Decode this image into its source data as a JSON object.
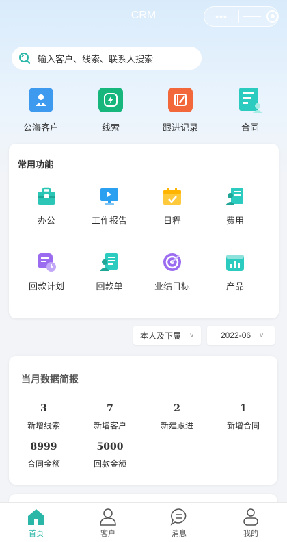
{
  "titlebar": {
    "title": "CRM",
    "menu_dots": "•••"
  },
  "search": {
    "placeholder": "输入客户、线索、联系人搜索"
  },
  "quick_entries": [
    {
      "label": "公海客户",
      "icon": "public-customer-icon",
      "color": "#3d9aef"
    },
    {
      "label": "线索",
      "icon": "lead-bolt-icon",
      "color": "#16b67c"
    },
    {
      "label": "跟进记录",
      "icon": "follow-record-icon",
      "color": "#f2683a"
    },
    {
      "label": "合同",
      "icon": "contract-icon",
      "color": "#2ccbc0"
    }
  ],
  "common_functions": {
    "title": "常用功能",
    "items": [
      {
        "label": "办公",
        "icon": "briefcase-icon"
      },
      {
        "label": "工作报告",
        "icon": "report-monitor-icon"
      },
      {
        "label": "日程",
        "icon": "calendar-check-icon"
      },
      {
        "label": "费用",
        "icon": "expense-icon"
      },
      {
        "label": "回款计划",
        "icon": "payment-plan-icon"
      },
      {
        "label": "回款单",
        "icon": "payment-receipt-icon"
      },
      {
        "label": "业绩目标",
        "icon": "target-icon"
      },
      {
        "label": "产品",
        "icon": "product-chart-icon"
      }
    ]
  },
  "filters": {
    "scope": "本人及下属",
    "month": "2022-06",
    "caret": "∨"
  },
  "monthly_report": {
    "title": "当月数据简报",
    "stats": [
      {
        "value": "3",
        "label": "新增线索"
      },
      {
        "value": "7",
        "label": "新增客户"
      },
      {
        "value": "2",
        "label": "新建跟进"
      },
      {
        "value": "1",
        "label": "新增合同"
      },
      {
        "value": "8999",
        "label": "合同金额"
      },
      {
        "value": "5000",
        "label": "回款金额"
      }
    ]
  },
  "tabbar": {
    "active_color": "#2bb7a8",
    "inactive_color": "#555555",
    "tabs": [
      {
        "label": "首页",
        "icon": "home-icon"
      },
      {
        "label": "客户",
        "icon": "customer-icon"
      },
      {
        "label": "消息",
        "icon": "message-icon"
      },
      {
        "label": "我的",
        "icon": "profile-icon"
      }
    ]
  }
}
